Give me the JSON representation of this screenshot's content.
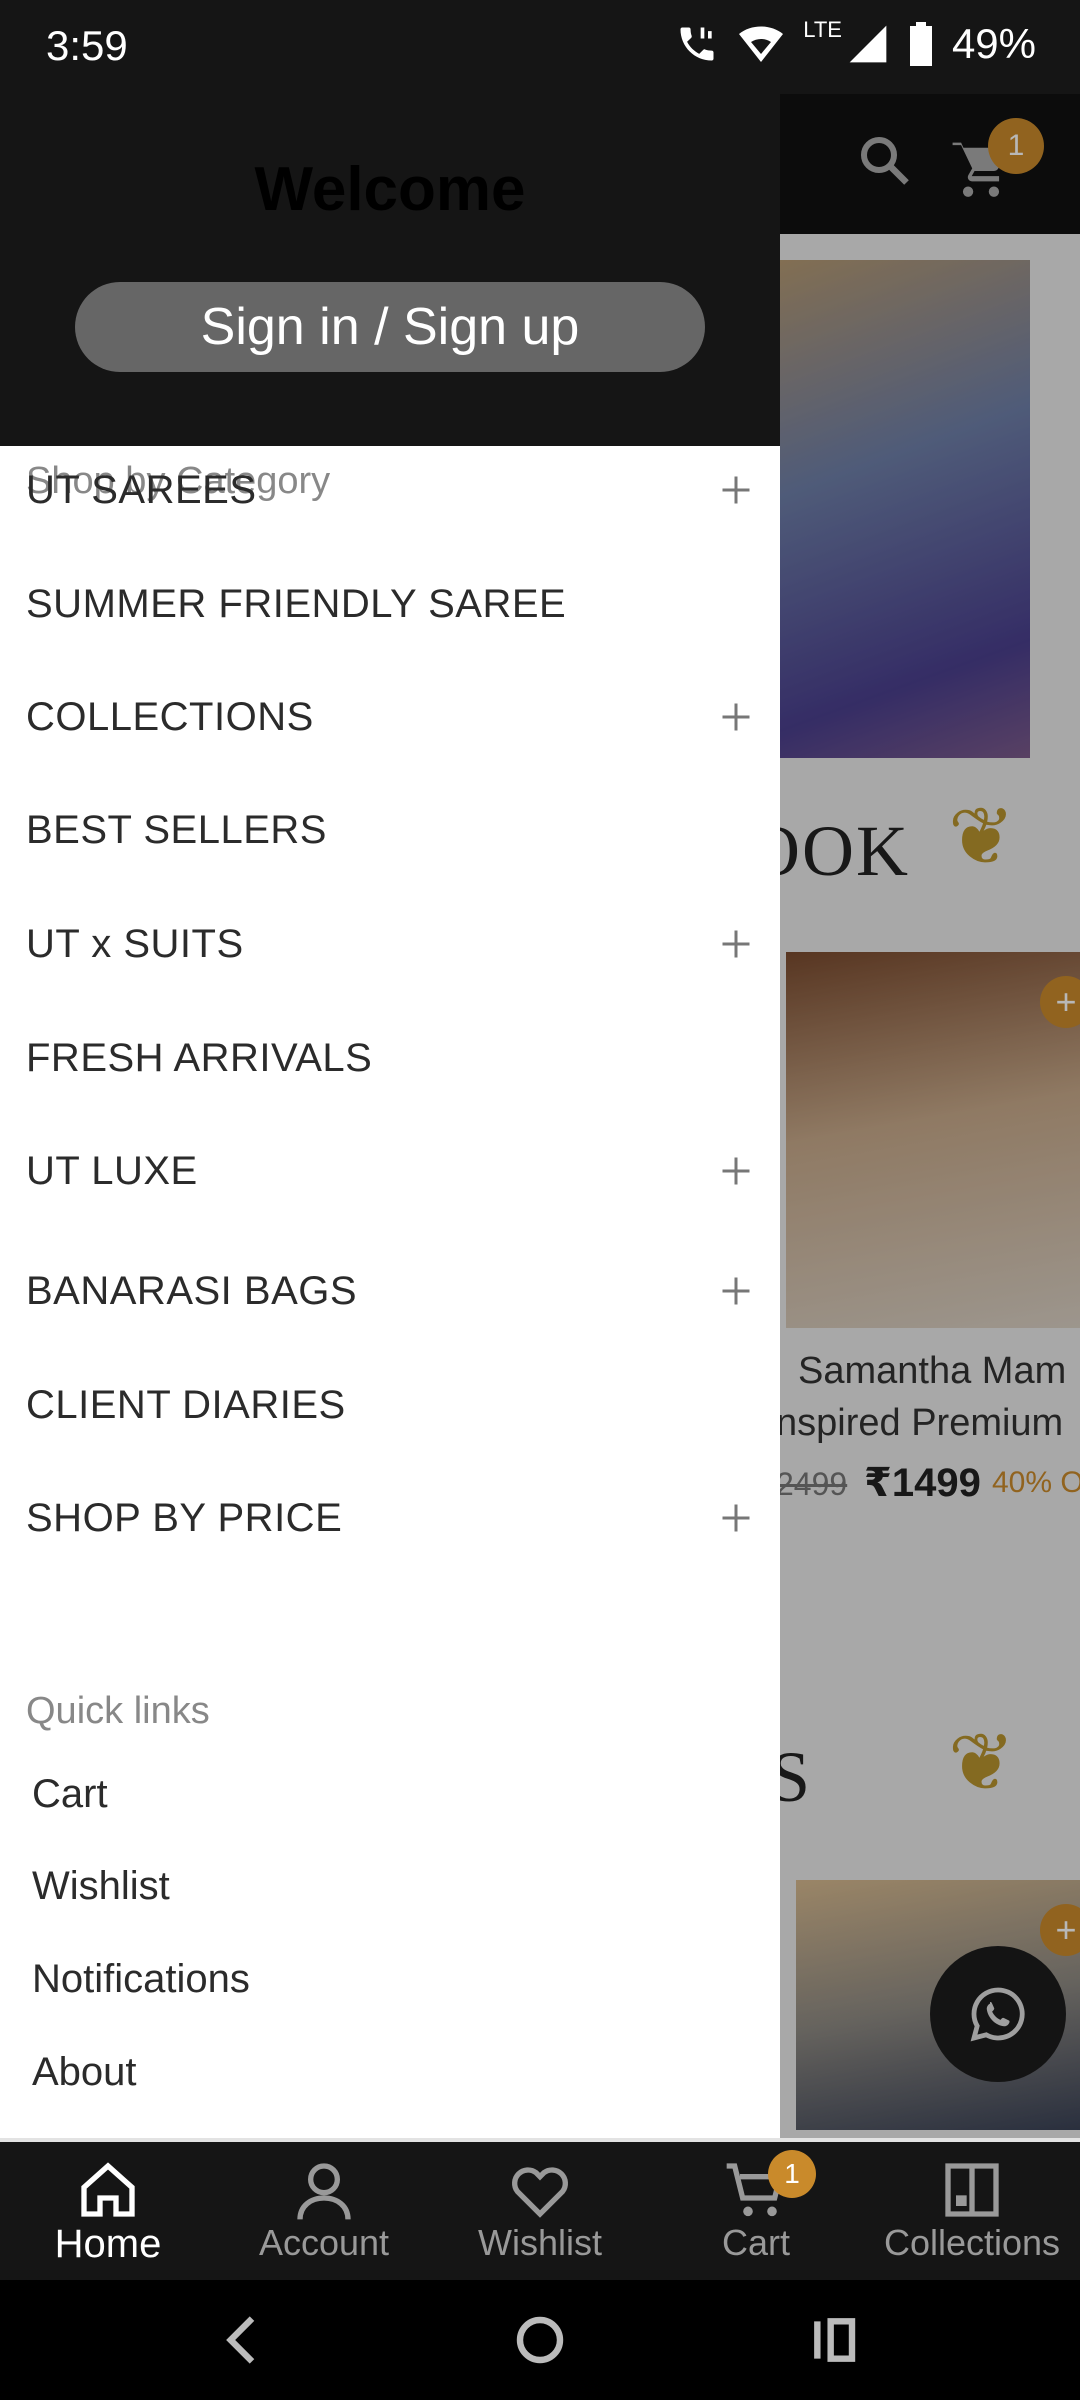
{
  "status_bar": {
    "time": "3:59",
    "battery": "49%",
    "network": "LTE"
  },
  "header": {
    "cart_badge": "1"
  },
  "drawer": {
    "welcome": "Welcome",
    "signin_label": "Sign in / Sign up",
    "category_heading": "Shop by Category",
    "categories": [
      {
        "label": "UT SAREES",
        "expandable": true
      },
      {
        "label": "SUMMER FRIENDLY SAREE",
        "expandable": false
      },
      {
        "label": "COLLECTIONS",
        "expandable": true
      },
      {
        "label": "BEST SELLERS",
        "expandable": false
      },
      {
        "label": "UT x SUITS",
        "expandable": true
      },
      {
        "label": "FRESH ARRIVALS",
        "expandable": false
      },
      {
        "label": "UT LUXE",
        "expandable": true
      },
      {
        "label": "BANARASI BAGS",
        "expandable": true
      },
      {
        "label": "CLIENT DIARIES",
        "expandable": false
      },
      {
        "label": "SHOP BY PRICE",
        "expandable": true
      }
    ],
    "quick_links_heading": "Quick links",
    "quick_links": [
      "Cart",
      "Wishlist",
      "Notifications",
      "About"
    ]
  },
  "background": {
    "section1_fragment": "OOK",
    "section2_fragment": "S",
    "product": {
      "title_line1": "Samantha Mam",
      "title_line2": "nspired Premium",
      "price_old": "2499",
      "price_new": "₹1499",
      "discount": "40% O"
    }
  },
  "bottom_nav": {
    "items": [
      {
        "label": "Home",
        "icon": "home-icon",
        "active": true
      },
      {
        "label": "Account",
        "icon": "account-icon",
        "active": false
      },
      {
        "label": "Wishlist",
        "icon": "heart-icon",
        "active": false
      },
      {
        "label": "Cart",
        "icon": "cart-icon",
        "active": false,
        "badge": "1"
      },
      {
        "label": "Collections",
        "icon": "collections-icon",
        "active": false
      }
    ]
  },
  "colors": {
    "accent": "#c98a2b",
    "header_bg": "#151515",
    "drawer_bg": "#ffffff"
  }
}
